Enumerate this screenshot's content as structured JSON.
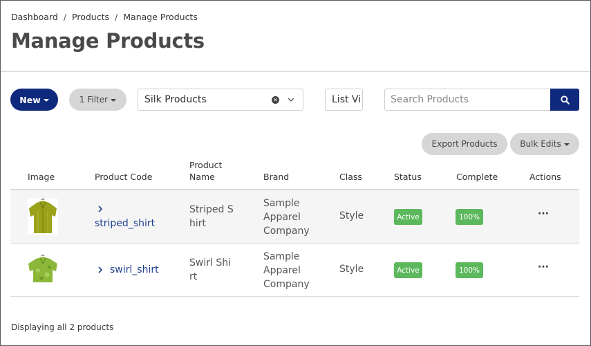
{
  "breadcrumb": {
    "items": [
      "Dashboard",
      "Products",
      "Manage Products"
    ],
    "separator": "/"
  },
  "page_title": "Manage Products",
  "toolbar": {
    "new_label": "New",
    "filter_label": "1 Filter",
    "saved_search_value": "Silk Products",
    "view_select_value": "List Vi",
    "search_placeholder": "Search Products",
    "export_label": "Export Products",
    "bulk_edits_label": "Bulk Edits"
  },
  "table": {
    "headers": {
      "image": "Image",
      "code": "Product Code",
      "name": "Product Name",
      "brand": "Brand",
      "class": "Class",
      "status": "Status",
      "complete": "Complete",
      "actions": "Actions"
    },
    "rows": [
      {
        "code": "striped_shirt",
        "name_line1": "Striped S",
        "name_line2": "hirt",
        "brand_line1": "Sample",
        "brand_line2": "Apparel",
        "brand_line3": "Company",
        "class": "Style",
        "status": "Active",
        "complete": "100%",
        "actions": "···",
        "thumb_icon": "striped-shirt-thumbnail"
      },
      {
        "code": "swirl_shirt",
        "name_line1": "Swirl Shi",
        "name_line2": "rt",
        "brand_line1": "Sample",
        "brand_line2": "Apparel",
        "brand_line3": "Company",
        "class": "Style",
        "status": "Active",
        "complete": "100%",
        "actions": "···",
        "thumb_icon": "swirl-shirt-thumbnail"
      }
    ]
  },
  "footer": {
    "prefix": "Displaying ",
    "emphasis": "all 2",
    "suffix": " products"
  },
  "colors": {
    "primary": "#0f2a7c",
    "pill_gray": "#d6d6d6",
    "success": "#5cb85c",
    "link": "#1f3f8f"
  }
}
